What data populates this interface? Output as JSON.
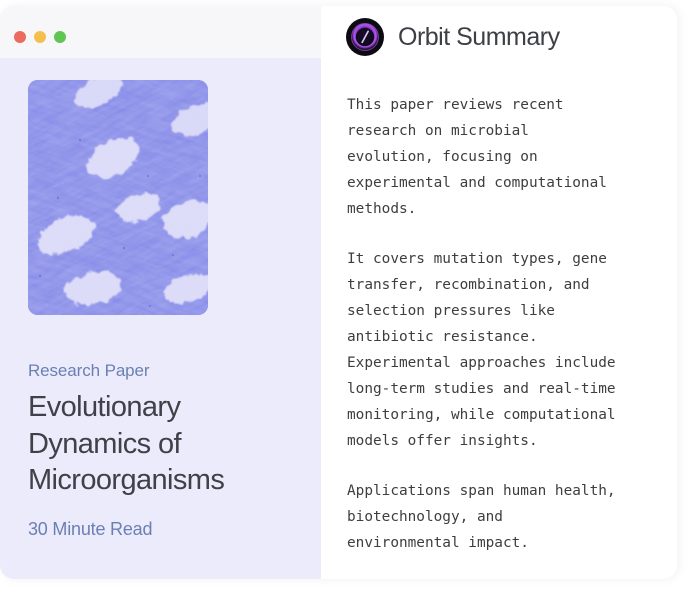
{
  "window": {
    "traffic_lights": [
      {
        "name": "close",
        "color": "#ec6a5e"
      },
      {
        "name": "minimize",
        "color": "#f5bf4f"
      },
      {
        "name": "maximize",
        "color": "#61c554"
      }
    ]
  },
  "left_panel": {
    "background": "#ecebfb",
    "thumbnail": {
      "icon": "microscopy-image",
      "alt": "Blue stained microscopy image of cells and fibrous tissue",
      "base_color": "#7b7fe8",
      "fiber_color": "#6f74e0",
      "blob_color": "#dcdcfb"
    },
    "kicker": "Research Paper",
    "kicker_color": "#6a80b5",
    "title": "Evolutionary Dynamics of Microorganisms",
    "title_color": "#3f4148",
    "read_time": "30 Minute Read",
    "read_time_color": "#6a80b5"
  },
  "right_panel": {
    "background": "#ffffff",
    "brand": {
      "logo_icon": "orbit-logo-icon",
      "logo_ring_color": "#a855f7",
      "logo_core_color": "#0b0b10",
      "title": "Orbit Summary",
      "title_color": "#3d3f44"
    },
    "summary": {
      "text_color": "#3e3e40",
      "paragraphs": [
        "This paper reviews recent\nresearch on microbial\nevolution, focusing on\nexperimental and computational\nmethods.",
        "It covers mutation types, gene\ntransfer, recombination, and\nselection pressures like\nantibiotic resistance.\nExperimental approaches include\nlong-term studies and real-time\nmonitoring, while computational\nmodels offer insights.",
        "Applications span human health,\nbiotechnology, and\nenvironmental impact."
      ]
    }
  }
}
